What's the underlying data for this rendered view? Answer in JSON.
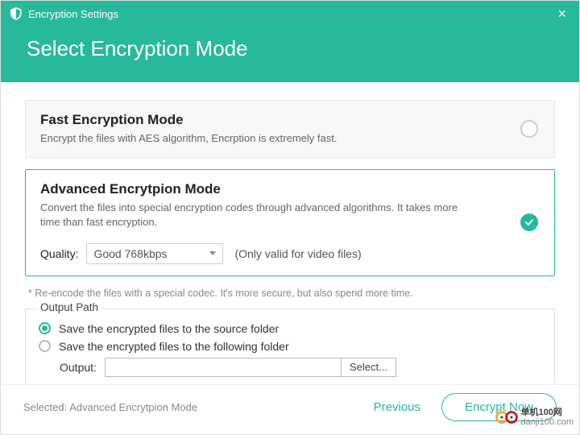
{
  "titlebar": {
    "title": "Encryption Settings"
  },
  "header": {
    "title": "Select Encryption Mode"
  },
  "modes": {
    "fast": {
      "title": "Fast Encryption Mode",
      "desc": "Encrypt the files with AES algorithm, Encrption is extremely fast."
    },
    "advanced": {
      "title": "Advanced Encrytpion Mode",
      "desc": "Convert the files into special encryption codes through advanced algorithms. It takes more time than fast encryption.",
      "quality_label": "Quality:",
      "quality_value": "Good 768kbps",
      "quality_note": "(Only valid for video files)"
    }
  },
  "footnote": "* Re-encode the files with a special codec. It's more secure, but also spend more time.",
  "output": {
    "legend": "Output Path",
    "opt_source": "Save the encrypted files to the source folder",
    "opt_custom": "Save the encrypted files to the following folder",
    "out_label": "Output:",
    "out_value": "",
    "select_btn": "Select..."
  },
  "footer": {
    "selected": "Selected: Advanced Encrytpion Mode",
    "previous": "Previous",
    "encrypt": "Encrypt Now"
  },
  "watermark": {
    "text_cn": "单机100网",
    "url": "danji100.com"
  }
}
